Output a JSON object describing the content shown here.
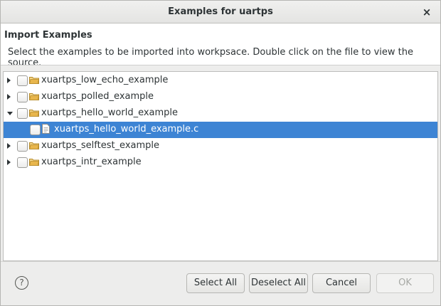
{
  "window": {
    "title": "Examples for uartps",
    "close_glyph": "×"
  },
  "header": {
    "title": "Import Examples",
    "description": "Select the examples to be imported into workpsace. Double click on the file to view the source."
  },
  "tree": {
    "items": [
      {
        "label": "xuartps_low_echo_example",
        "type": "folder",
        "expanded": false,
        "checked": false,
        "selected": false,
        "level": 0
      },
      {
        "label": "xuartps_polled_example",
        "type": "folder",
        "expanded": false,
        "checked": false,
        "selected": false,
        "level": 0
      },
      {
        "label": "xuartps_hello_world_example",
        "type": "folder",
        "expanded": true,
        "checked": false,
        "selected": false,
        "level": 0
      },
      {
        "label": "xuartps_hello_world_example.c",
        "type": "file",
        "checked": false,
        "selected": true,
        "level": 1
      },
      {
        "label": "xuartps_selftest_example",
        "type": "folder",
        "expanded": false,
        "checked": false,
        "selected": false,
        "level": 0
      },
      {
        "label": "xuartps_intr_example",
        "type": "folder",
        "expanded": false,
        "checked": false,
        "selected": false,
        "level": 0
      }
    ]
  },
  "footer": {
    "help_glyph": "?",
    "select_all": "Select All",
    "deselect_all": "Deselect All",
    "cancel": "Cancel",
    "ok": "OK",
    "ok_enabled": false
  },
  "colors": {
    "selection": "#3d84d4",
    "folder": "#e8b64c"
  }
}
